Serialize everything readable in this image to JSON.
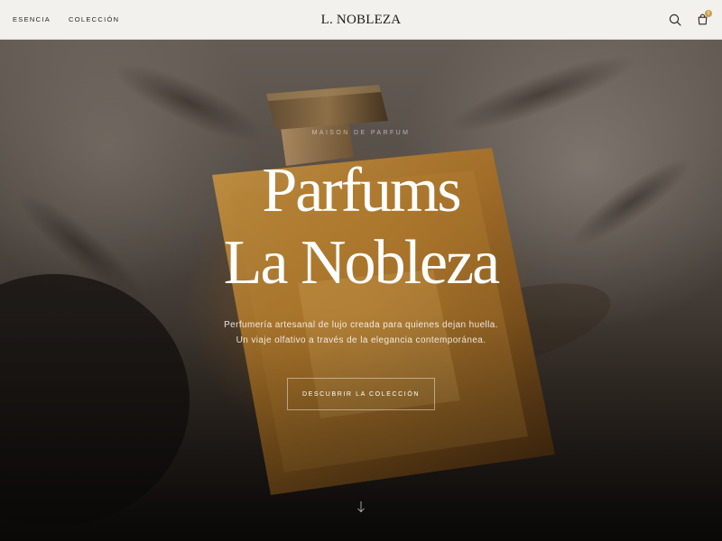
{
  "header": {
    "nav": [
      {
        "label": "Esencia"
      },
      {
        "label": "Colección"
      }
    ],
    "logo": "L. NOBLEZA",
    "icons": {
      "search": "search-icon",
      "bag": "shopping-bag-icon"
    },
    "cart_count": "0"
  },
  "hero": {
    "eyebrow": "Maison de Parfum",
    "title_line1": "Parfums",
    "title_line2": "La Nobleza",
    "subtitle": "Perfumería artesanal de lujo creada para quienes dejan huella. Un viaje olfativo a través de la elegancia contemporánea.",
    "cta_label": "Descubrir la colección",
    "scroll_icon": "arrow-down-icon"
  },
  "colors": {
    "header_bg": "#f2f1ee",
    "accent": "#c9a04c",
    "amber": "#c08a3a",
    "text_dark": "#1c1916"
  }
}
